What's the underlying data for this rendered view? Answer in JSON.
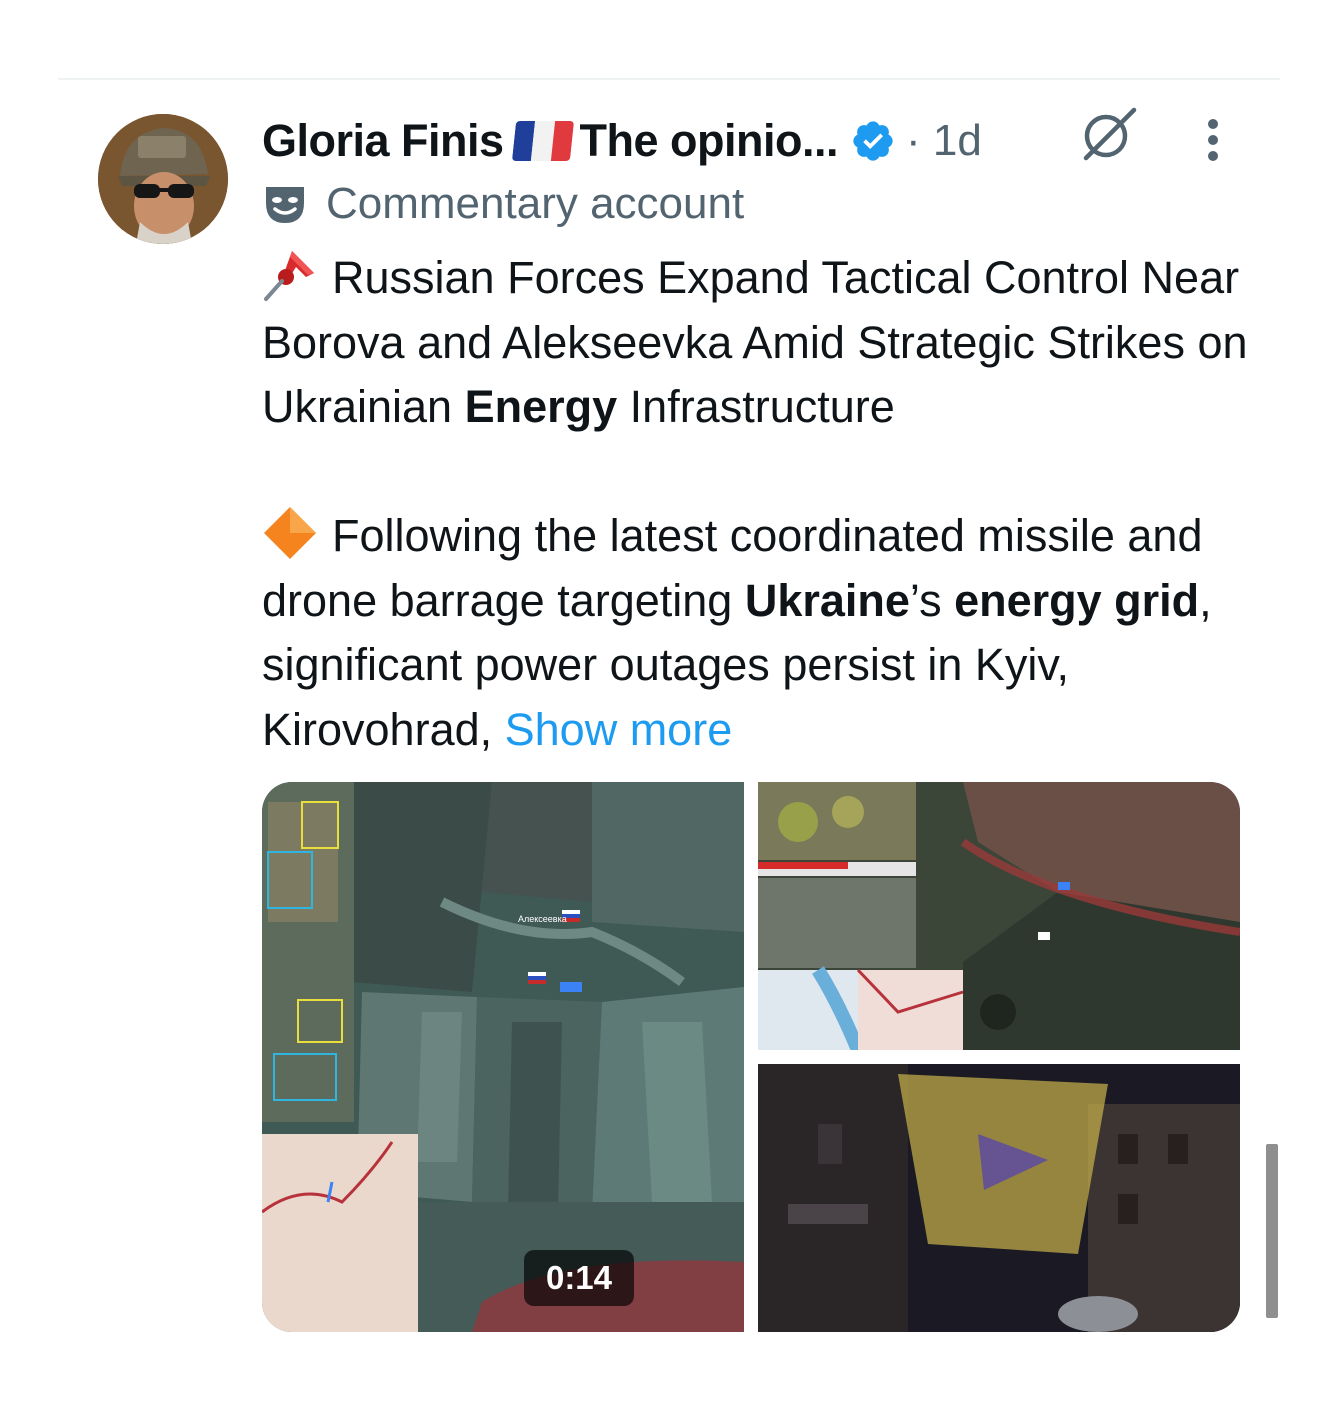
{
  "post": {
    "author_name": "Gloria Finis",
    "author_name_suffix": "The opinio...",
    "time": "· 1d",
    "label": "Commentary account",
    "paragraph1": {
      "text": "Russian Forces Expand Tactical Control Near Borova and Alekseevka Amid Strategic Strikes on Ukrainian ",
      "bold": "Energy",
      "after": " Infrastructure"
    },
    "paragraph2": {
      "part1": "Following the latest coordinated missile and drone barrage targeting ",
      "bold1": "Ukraine",
      "part2": "’s ",
      "bold2": "energy grid",
      "part3": ", significant power outages persist in Kyiv, Kirovohrad, ",
      "show_more": "Show more"
    },
    "media": {
      "video_duration": "0:14",
      "map1_label": "Алексеевка"
    }
  },
  "colors": {
    "text": "#0f1419",
    "secondary": "#536471",
    "link": "#1d9bf0",
    "verified": "#1d9bf0",
    "divider": "#eff3f4"
  }
}
